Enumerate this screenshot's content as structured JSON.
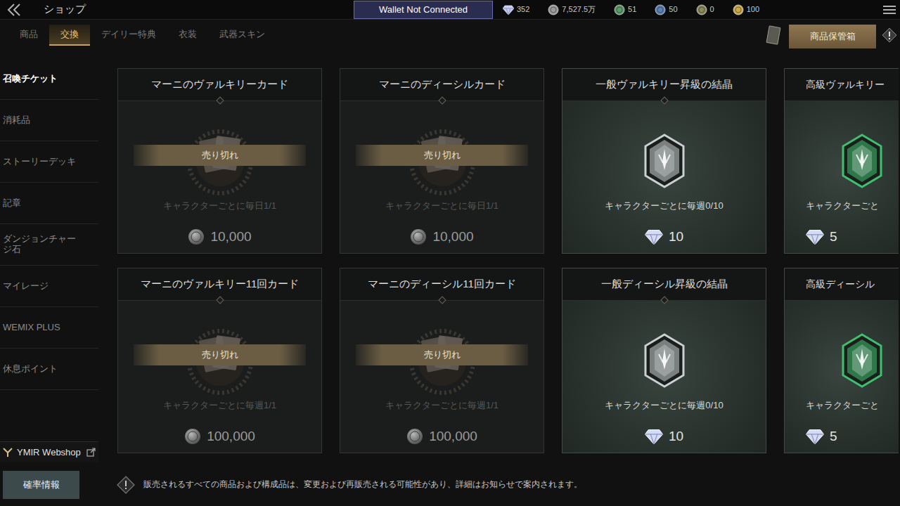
{
  "header": {
    "title": "ショップ",
    "wallet": "Wallet Not Connected",
    "currencies": [
      {
        "value": "352",
        "kind": "gem",
        "color": "#c4ccf0"
      },
      {
        "value": "7,527.5万",
        "kind": "coin",
        "color": "#9a9a9a"
      },
      {
        "value": "51",
        "kind": "coin",
        "color": "#5f9a6c"
      },
      {
        "value": "50",
        "kind": "coin",
        "color": "#5c7fb5"
      },
      {
        "value": "0",
        "kind": "coin",
        "color": "#8c8a5c"
      },
      {
        "value": "100",
        "kind": "coin",
        "color": "#c9a94c"
      }
    ]
  },
  "tabs": [
    {
      "label": "商品",
      "selected": false
    },
    {
      "label": "交換",
      "selected": true
    },
    {
      "label": "デイリー特典",
      "selected": false
    },
    {
      "label": "衣装",
      "selected": false
    },
    {
      "label": "武器スキン",
      "selected": false
    }
  ],
  "storage_button": "商品保管箱",
  "sidebar": {
    "items": [
      {
        "label": "召喚チケット",
        "selected": true
      },
      {
        "label": "消耗品",
        "selected": false
      },
      {
        "label": "ストーリーデッキ",
        "selected": false
      },
      {
        "label": "記章",
        "selected": false
      },
      {
        "label": "ダンジョンチャージ石",
        "selected": false
      },
      {
        "label": "マイレージ",
        "selected": false
      },
      {
        "label": "WEMIX PLUS",
        "selected": false
      },
      {
        "label": "休息ポイント",
        "selected": false
      }
    ],
    "webshop": "YMIR Webshop"
  },
  "products": [
    {
      "title": "マーニのヴァルキリーカード",
      "kind": "ticket",
      "sold_out": true,
      "badge": "売り切れ",
      "limit": "キャラクターごとに毎日1/1",
      "price": "10,000",
      "currency": "silver",
      "color": "#6a625a"
    },
    {
      "title": "マーニのディーシルカード",
      "kind": "ticket",
      "sold_out": true,
      "badge": "売り切れ",
      "limit": "キャラクターごとに毎日1/1",
      "price": "10,000",
      "currency": "silver",
      "color": "#6a625a"
    },
    {
      "title": "一般ヴァルキリー昇級の結晶",
      "kind": "crystal",
      "sold_out": false,
      "badge": "",
      "limit": "キャラクターごとに毎週0/10",
      "price": "10",
      "currency": "diamond",
      "color": "#c9cfd2"
    },
    {
      "title": "高級ヴァルキリー",
      "kind": "crystal",
      "sold_out": false,
      "badge": "",
      "limit": "キャラクターごと",
      "price": "5",
      "currency": "diamond",
      "color": "#3fbf6f"
    },
    {
      "title": "マーニのヴァルキリー11回カード",
      "kind": "ticket",
      "sold_out": true,
      "badge": "売り切れ",
      "limit": "キャラクターごとに毎週1/1",
      "price": "100,000",
      "currency": "silver",
      "color": "#6a625a"
    },
    {
      "title": "マーニのディーシル11回カード",
      "kind": "ticket",
      "sold_out": true,
      "badge": "売り切れ",
      "limit": "キャラクターごとに毎週1/1",
      "price": "100,000",
      "currency": "silver",
      "color": "#6a625a"
    },
    {
      "title": "一般ディーシル昇級の結晶",
      "kind": "crystal",
      "sold_out": false,
      "badge": "",
      "limit": "キャラクターごとに毎週0/10",
      "price": "10",
      "currency": "diamond",
      "color": "#c9cfd2"
    },
    {
      "title": "高級ディーシル",
      "kind": "crystal",
      "sold_out": false,
      "badge": "",
      "limit": "キャラクターごと",
      "price": "5",
      "currency": "diamond",
      "color": "#3fbf6f"
    }
  ],
  "footer": {
    "odds_button": "確率情報",
    "notice": "販売されるすべての商品および構成品は、変更および再販売される可能性があり、詳細はお知らせで案内されます。"
  }
}
